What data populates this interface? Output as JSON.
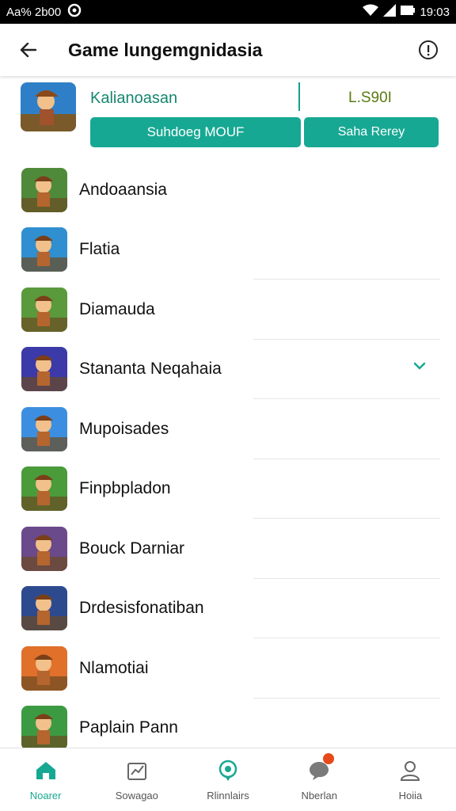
{
  "status_bar": {
    "left_text": "Aa% 2b00",
    "time": "19:03"
  },
  "header": {
    "title": "Game lungemgnidasia"
  },
  "featured": {
    "title": "Kalianoasan",
    "value": "L.S90I",
    "primary_button": "Suhdoeg MOUF",
    "secondary_button": "Saha Rerey"
  },
  "games": [
    {
      "label": "Andoaansia",
      "bg": "#4f8a3a"
    },
    {
      "label": "Flatia",
      "bg": "#2f8fd0"
    },
    {
      "label": "Diamauda",
      "bg": "#5a9a3c"
    },
    {
      "label": "Stananta Neqahaia",
      "bg": "#3b3aa8",
      "checked": true
    },
    {
      "label": "Mupoisades",
      "bg": "#3c8fe0"
    },
    {
      "label": "Finpbpladon",
      "bg": "#4a9b3a"
    },
    {
      "label": "Bouck Darniar",
      "bg": "#6a4a8a"
    },
    {
      "label": "Drdesisfonatiban",
      "bg": "#2e4a8f"
    },
    {
      "label": "Nlamotiai",
      "bg": "#e0702a"
    },
    {
      "label": "Paplain Pann",
      "bg": "#3c9a42"
    }
  ],
  "nav": {
    "items": [
      {
        "label": "Noarer",
        "icon": "home-icon",
        "active": true
      },
      {
        "label": "Sowagao",
        "icon": "chart-icon"
      },
      {
        "label": "Rlinnlairs",
        "icon": "location-icon"
      },
      {
        "label": "Nberlan",
        "icon": "chat-icon",
        "badge": true
      },
      {
        "label": "Hoiia",
        "icon": "person-icon"
      }
    ]
  },
  "colors": {
    "accent": "#17a893",
    "text": "#111111"
  }
}
